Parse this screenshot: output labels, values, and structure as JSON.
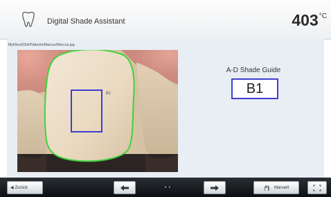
{
  "header": {
    "icon": "tooth-icon",
    "title": "Digital Shade Assistant",
    "temperature": "403",
    "temperature_unit": "°C"
  },
  "content": {
    "file_path": "MyFiles/DSA/Patients/Marcus/Marcus.jpg",
    "guide_label": "A-D Shade Guide",
    "shade_value": "B1",
    "selection_marker": "B1",
    "colors": {
      "tooth_outline": "#40d23c",
      "selection_box": "#3e3ed0",
      "content_background": "#e8eef4"
    }
  },
  "toolbar": {
    "back_label": "Zurück",
    "dots": "• •",
    "manual_label": "Manuell",
    "icons": [
      "back-arrow-icon",
      "arrow-left-icon",
      "arrow-right-icon",
      "hand-icon",
      "fullscreen-icon"
    ]
  }
}
